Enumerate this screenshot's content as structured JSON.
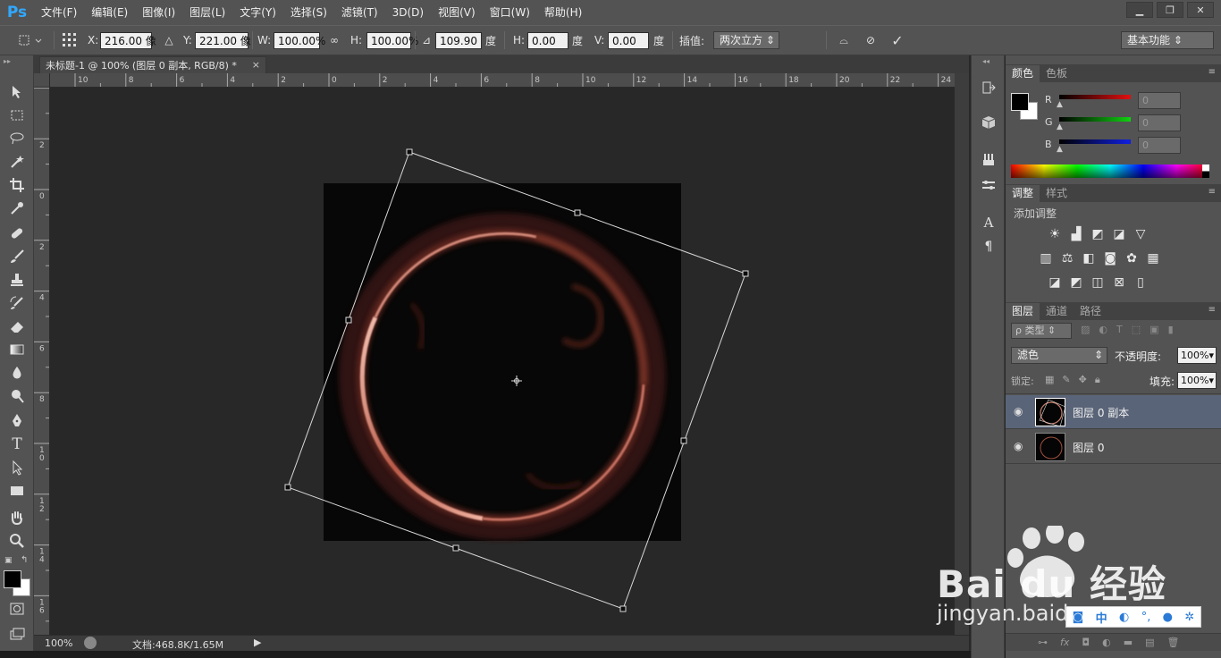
{
  "app": {
    "logo": "Ps",
    "menus": [
      "文件(F)",
      "编辑(E)",
      "图像(I)",
      "图层(L)",
      "文字(Y)",
      "选择(S)",
      "滤镜(T)",
      "3D(D)",
      "视图(V)",
      "窗口(W)",
      "帮助(H)"
    ]
  },
  "options": {
    "x_label": "X:",
    "x_value": "216.00 像",
    "y_label": "Y:",
    "y_value": "221.00 像",
    "w_label": "W:",
    "w_value": "100.00%",
    "h_label": "H:",
    "h_value": "100.00%",
    "angle_value": "109.90",
    "angle_unit": "度",
    "hskew_label": "H:",
    "hskew_value": "0.00",
    "hskew_unit": "度",
    "vskew_label": "V:",
    "vskew_value": "0.00",
    "vskew_unit": "度",
    "interp_label": "插值:",
    "interp_value": "两次立方",
    "workspace": "基本功能"
  },
  "document": {
    "tab_title": "未标题-1 @ 100% (图层 0 副本, RGB/8) *",
    "close": "×",
    "zoom": "100%",
    "doc_info": "文档:468.8K/1.65M"
  },
  "rulers": {
    "h_ticks": [
      "10",
      "8",
      "6",
      "4",
      "2",
      "0",
      "2",
      "4",
      "6",
      "8",
      "10",
      "12",
      "14",
      "16",
      "18",
      "20",
      "22",
      "24"
    ],
    "v_ticks": [
      "2",
      "0",
      "2",
      "4",
      "6",
      "8",
      "10",
      "12",
      "14",
      "16"
    ]
  },
  "color_panel": {
    "tabs": [
      "颜色",
      "色板"
    ],
    "r_label": "R",
    "g_label": "G",
    "b_label": "B",
    "r_value": "0",
    "g_value": "0",
    "b_value": "0",
    "foreground": "#000000",
    "background": "#ffffff"
  },
  "adjust_panel": {
    "tabs": [
      "调整",
      "样式"
    ],
    "title": "添加调整"
  },
  "layers_panel": {
    "tabs": [
      "图层",
      "通道",
      "路径"
    ],
    "filter_kind": "ρ 类型",
    "blend_mode": "滤色",
    "opacity_label": "不透明度:",
    "opacity_value": "100%",
    "lock_label": "锁定:",
    "fill_label": "填充:",
    "fill_value": "100%",
    "layers": [
      {
        "name": "图层 0 副本",
        "selected": true
      },
      {
        "name": "图层 0",
        "selected": false
      }
    ]
  },
  "watermark": {
    "brand": "Bai du 经验",
    "url": "jingyan.baidu.com",
    "ime_label": "中"
  }
}
